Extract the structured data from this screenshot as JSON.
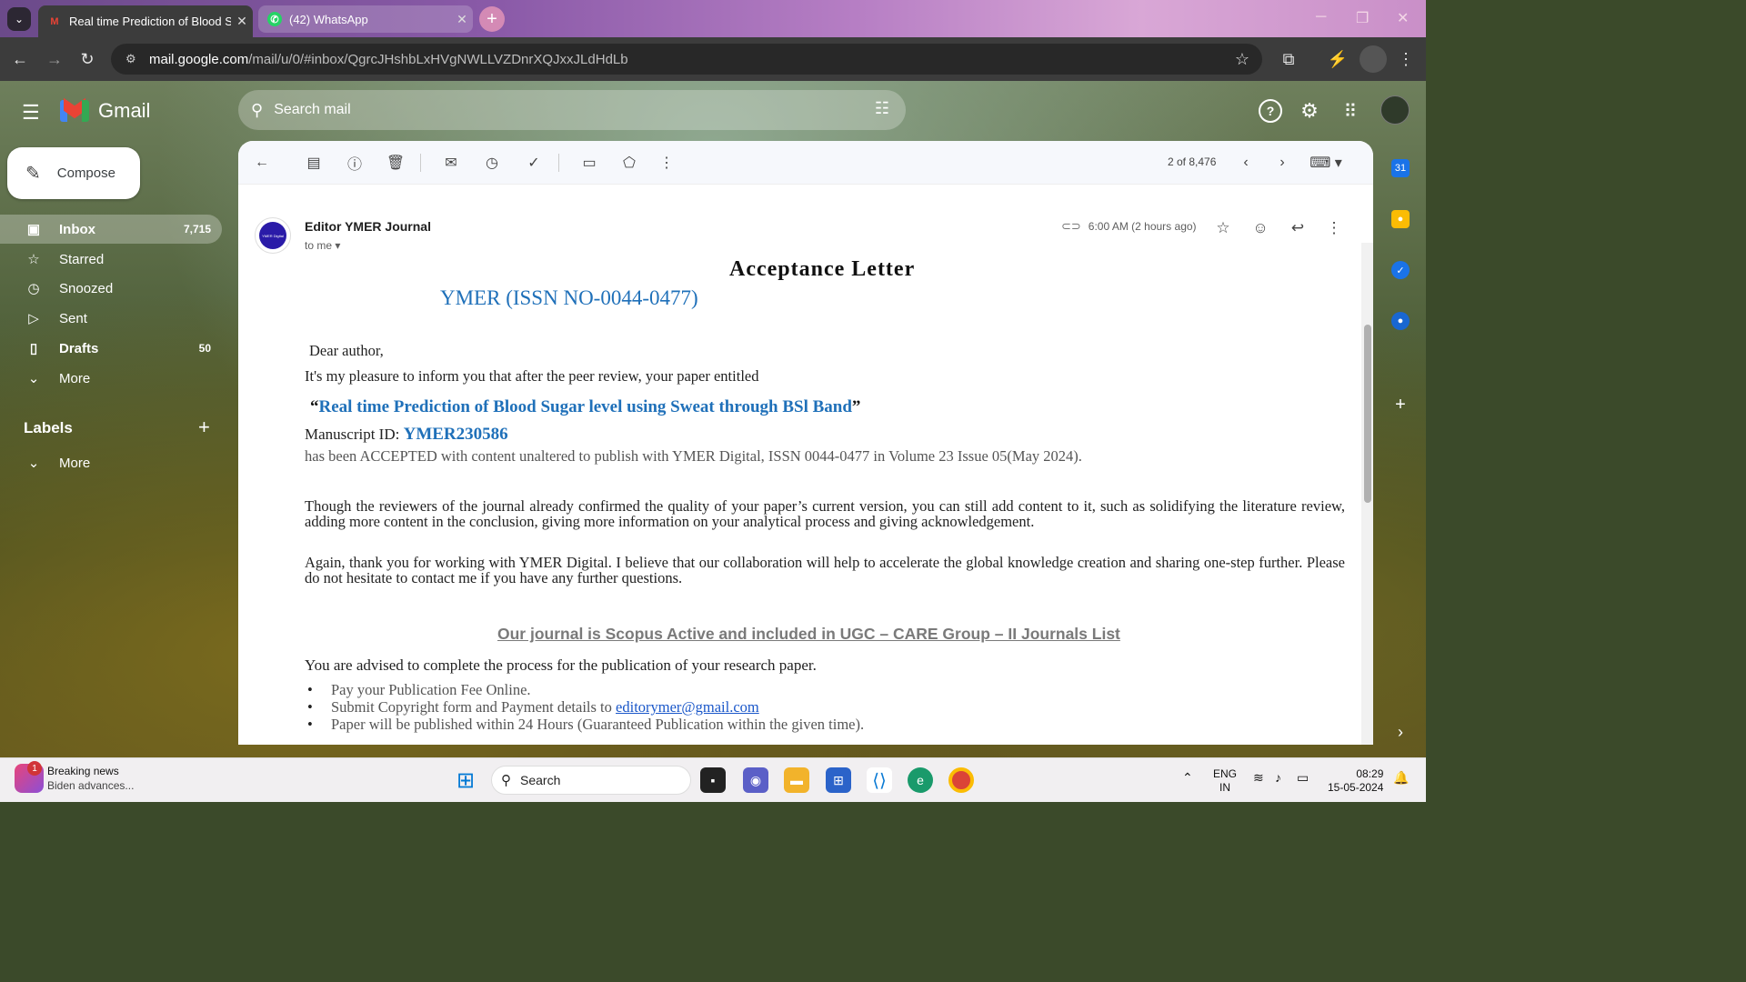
{
  "browser": {
    "tabs": [
      {
        "title": "Real time Prediction of Blood Su",
        "close": "✕",
        "active": true
      },
      {
        "title": "(42) WhatsApp",
        "close": "✕",
        "active": false
      }
    ],
    "new_tab": "+",
    "url_host": "mail.google.com",
    "url_path": "/mail/u/0/#inbox/QgrcJHshbLxHVgNWLLVZDnrXQJxxJLdHdLb"
  },
  "gmail": {
    "brand": "Gmail",
    "search_placeholder": "Search mail",
    "compose": "Compose",
    "nav": [
      {
        "label": "Inbox",
        "count": "7,715"
      },
      {
        "label": "Starred",
        "count": ""
      },
      {
        "label": "Snoozed",
        "count": ""
      },
      {
        "label": "Sent",
        "count": ""
      },
      {
        "label": "Drafts",
        "count": "50"
      },
      {
        "label": "More",
        "count": ""
      }
    ],
    "labels_heading": "Labels",
    "labels_more": "More",
    "pager": "2 of 8,476"
  },
  "email": {
    "sender": "Editor YMER Journal",
    "to": "to me",
    "time": "6:00 AM (2 hours ago)",
    "avatar_text": "YMER Digital",
    "title": "Acceptance Letter",
    "subtitle": "YMER (ISSN NO-0044-0477)",
    "greeting": "Dear author,",
    "intro": "It's my pleasure to inform you that after the peer review, your paper entitled",
    "paper_title": "Real time Prediction of Blood Sugar level using Sweat through BSl Band",
    "quote_open": "“",
    "quote_close": "”",
    "manuscript_label": "Manuscript ID:",
    "manuscript_id": "YMER230586",
    "accepted": "has been ACCEPTED with content unaltered to publish with YMER Digital, ISSN 0044-0477 in Volume 23 Issue 05(May 2024).",
    "para1": "Though the reviewers of the journal already confirmed the quality of your paper’s current version, you can still add content to it, such as solidifying the literature review, adding more content in the conclusion, giving more information on your analytical process and giving acknowledgement.",
    "para2": "Again, thank you for working with YMER Digital. I believe that our collaboration will help to accelerate the global knowledge creation and sharing one-step further. Please do not hesitate to contact me if you have any further questions.",
    "scopus": "Our journal is Scopus Active and included in UGC – CARE Group – II Journals List",
    "advised": "You are advised to complete the process for the publication of your research paper.",
    "bullet1": "Pay your Publication Fee Online.",
    "bullet2_prefix": "Submit Copyright form and Payment details to ",
    "bullet2_email": "editorymer@gmail.com",
    "bullet3": "Paper will be published within 24 Hours (Guaranteed Publication within the given time)."
  },
  "taskbar": {
    "news_title": "Breaking news",
    "news_sub": "Biden advances...",
    "news_badge": "1",
    "search": "Search",
    "lang1": "ENG",
    "lang2": "IN",
    "time": "08:29",
    "date": "15-05-2024"
  },
  "colors": {
    "link_blue": "#1f70b9",
    "chrome_dark": "#3c3c3c"
  }
}
